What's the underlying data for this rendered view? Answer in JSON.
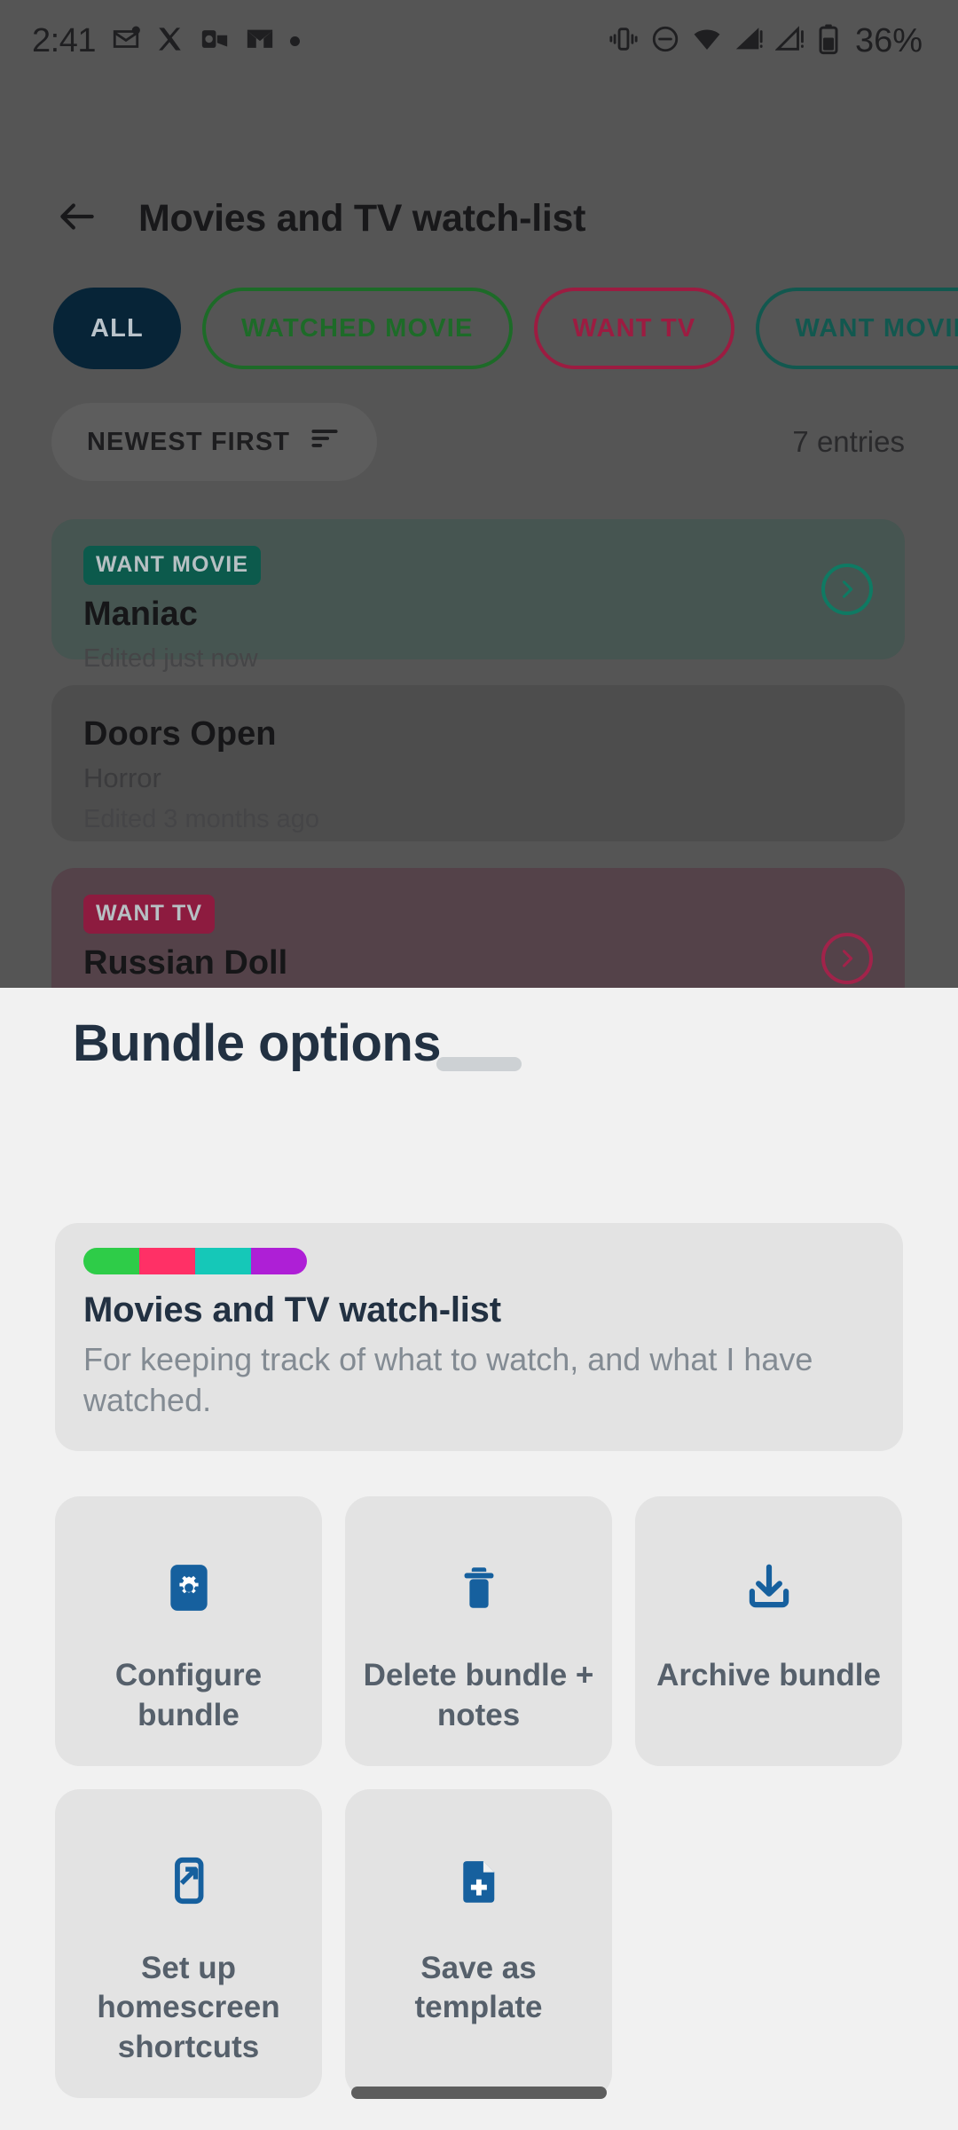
{
  "status_bar": {
    "time": "2:41",
    "battery_percent": "36%",
    "left_icons": [
      "mail-icon",
      "x-twitter-icon",
      "outlook-icon",
      "gmail-icon",
      "dot-icon"
    ],
    "right_icons": [
      "vibrate-icon",
      "do-not-disturb-icon",
      "wifi-icon",
      "signal-icon",
      "signal-alert-icon",
      "battery-icon"
    ]
  },
  "app_bar": {
    "back_icon": "arrow-left-icon",
    "title": "Movies and TV watch-list"
  },
  "filters": {
    "chips": [
      {
        "label": "ALL",
        "selected": true,
        "color": "#072437"
      },
      {
        "label": "WATCHED MOVIE",
        "selected": false,
        "color": "#1d6b28"
      },
      {
        "label": "WANT TV",
        "selected": false,
        "color": "#9c1c41"
      },
      {
        "label": "WANT MOVIE",
        "selected": false,
        "color": "#12584f"
      }
    ]
  },
  "sort_row": {
    "sort_label": "NEWEST FIRST",
    "sort_icon": "sort-icon",
    "entries_count": "7 entries"
  },
  "entries": [
    {
      "tag": "WANT MOVIE",
      "tag_color": "#0c5a4c",
      "title": "Maniac",
      "subtitle": "",
      "edited": "Edited just now",
      "accent": "#0f7a63",
      "card_bg": "#465551",
      "has_chevron": true
    },
    {
      "tag": "",
      "tag_color": "",
      "title": "Doors Open",
      "subtitle": "Horror",
      "edited": "Edited 3 months ago",
      "accent": "",
      "card_bg": "#4d4d4d",
      "has_chevron": false
    },
    {
      "tag": "WANT TV",
      "tag_color": "#8d1b3f",
      "title": "Russian Doll",
      "subtitle": "",
      "edited": "",
      "accent": "#a1234a",
      "card_bg": "#544249",
      "has_chevron": true
    }
  ],
  "sheet": {
    "drag_handle": "drag-handle",
    "title": "Bundle options",
    "bundle": {
      "colors": [
        "#2ecc48",
        "#ff3066",
        "#15c8b8",
        "#ae1fd6"
      ],
      "name": "Movies and TV watch-list",
      "description": "For keeping track of what to watch, and what I have watched."
    },
    "actions": [
      {
        "icon": "gear-icon",
        "label": "Configure bundle"
      },
      {
        "icon": "trash-icon",
        "label": "Delete bundle + notes"
      },
      {
        "icon": "archive-download-icon",
        "label": "Archive bundle"
      },
      {
        "icon": "homescreen-shortcut-icon",
        "label": "Set up homescreen shortcuts"
      },
      {
        "icon": "document-plus-icon",
        "label": "Save as template"
      }
    ],
    "accent_color": "#16609e"
  },
  "nav_bar": {
    "pill": "gesture-pill"
  }
}
